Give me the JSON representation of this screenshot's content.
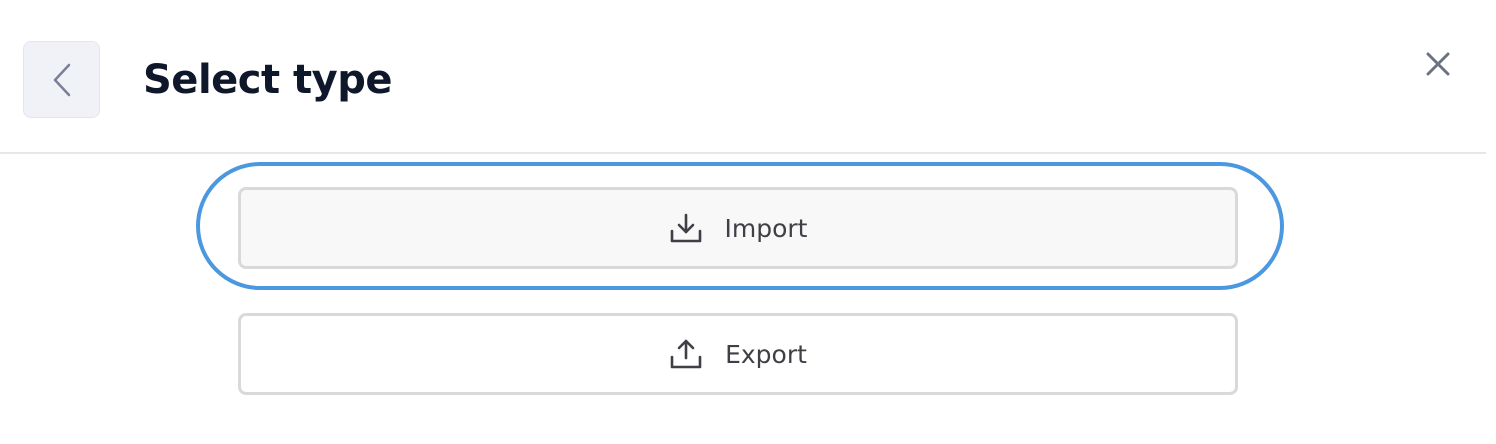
{
  "header": {
    "title": "Select type",
    "back_icon": "chevron-left-icon",
    "close_icon": "close-icon"
  },
  "options": [
    {
      "label": "Import",
      "icon": "download-icon"
    },
    {
      "label": "Export",
      "icon": "upload-icon"
    }
  ],
  "colors": {
    "title": "#0f172a",
    "highlight": "#4b98e0",
    "option_border": "#d9d9d9",
    "back_button_bg": "#f1f2f7"
  }
}
